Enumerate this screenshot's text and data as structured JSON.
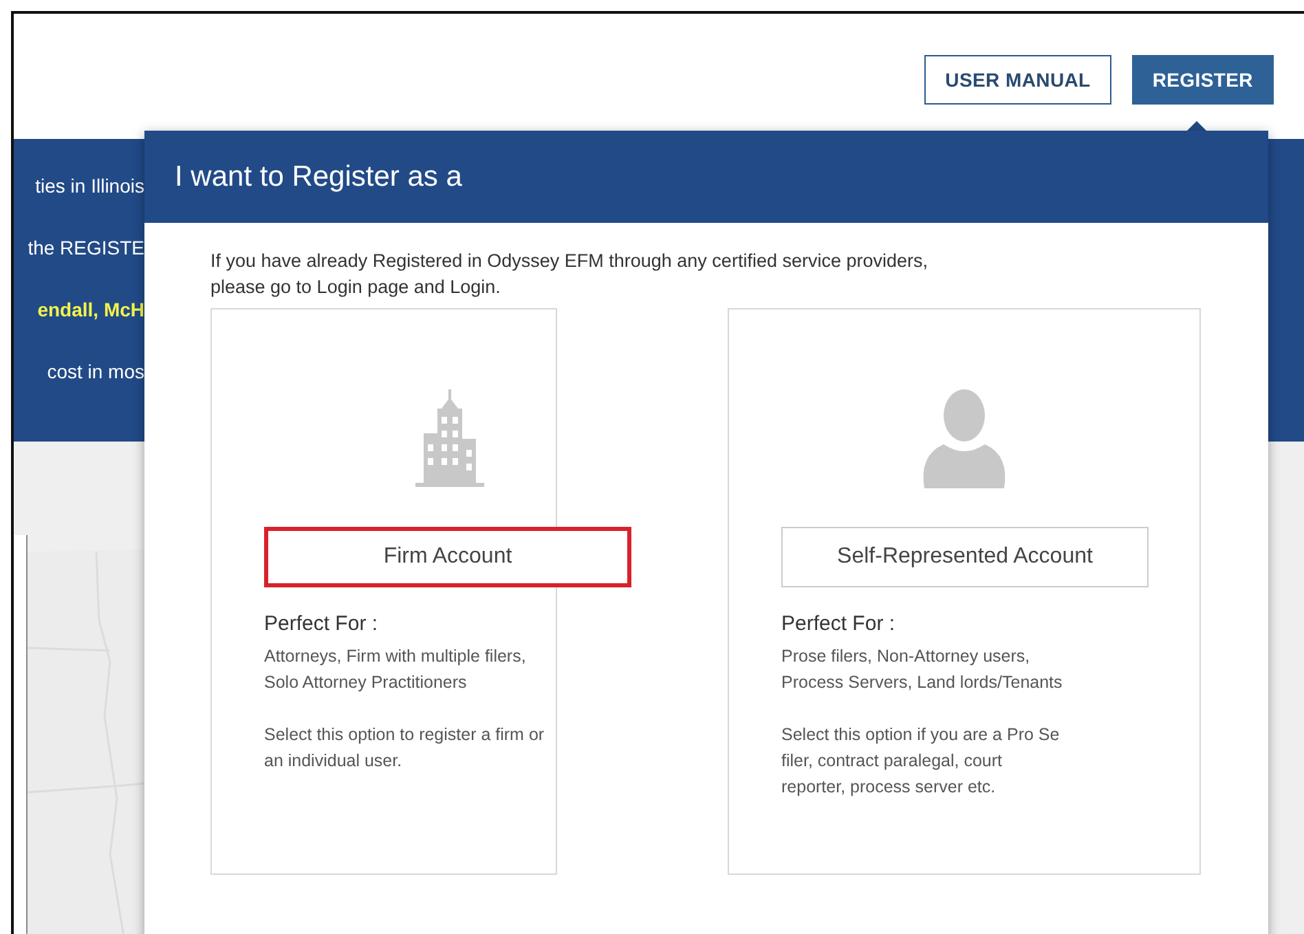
{
  "header": {
    "buttons": [
      {
        "label": "USER MANUAL",
        "kind": "outline"
      },
      {
        "label": "REGISTER",
        "kind": "primary"
      }
    ]
  },
  "banner": {
    "lines": [
      {
        "text": "ties in Illinois",
        "highlight": false
      },
      {
        "text": "the REGISTE",
        "highlight": false
      },
      {
        "text": "endall, McH",
        "highlight": true
      },
      {
        "text": "cost in mos",
        "highlight": false
      }
    ]
  },
  "dialog": {
    "title": "I want to Register as a",
    "intro": [
      "If you have already Registered in Odyssey EFM through any certified service providers,",
      "please go to Login page and Login."
    ],
    "options": [
      {
        "kind": "firm",
        "label": "Firm Account",
        "highlighted": true,
        "heading": "Perfect For :",
        "audience": [
          "Attorneys, Firm with multiple filers,",
          "Solo Attorney Practitioners"
        ],
        "description": [
          "Select this option to register a firm or",
          "an individual user."
        ]
      },
      {
        "kind": "individual",
        "label": "Self-Represented Account",
        "highlighted": false,
        "heading": "Perfect For :",
        "audience": [
          "Prose filers, Non-Attorney users,",
          "Process Servers, Land lords/Tenants"
        ],
        "description": [
          "Select this option if you are a Pro Se",
          "filer, contract paralegal, court",
          "reporter, process server etc."
        ]
      }
    ]
  }
}
